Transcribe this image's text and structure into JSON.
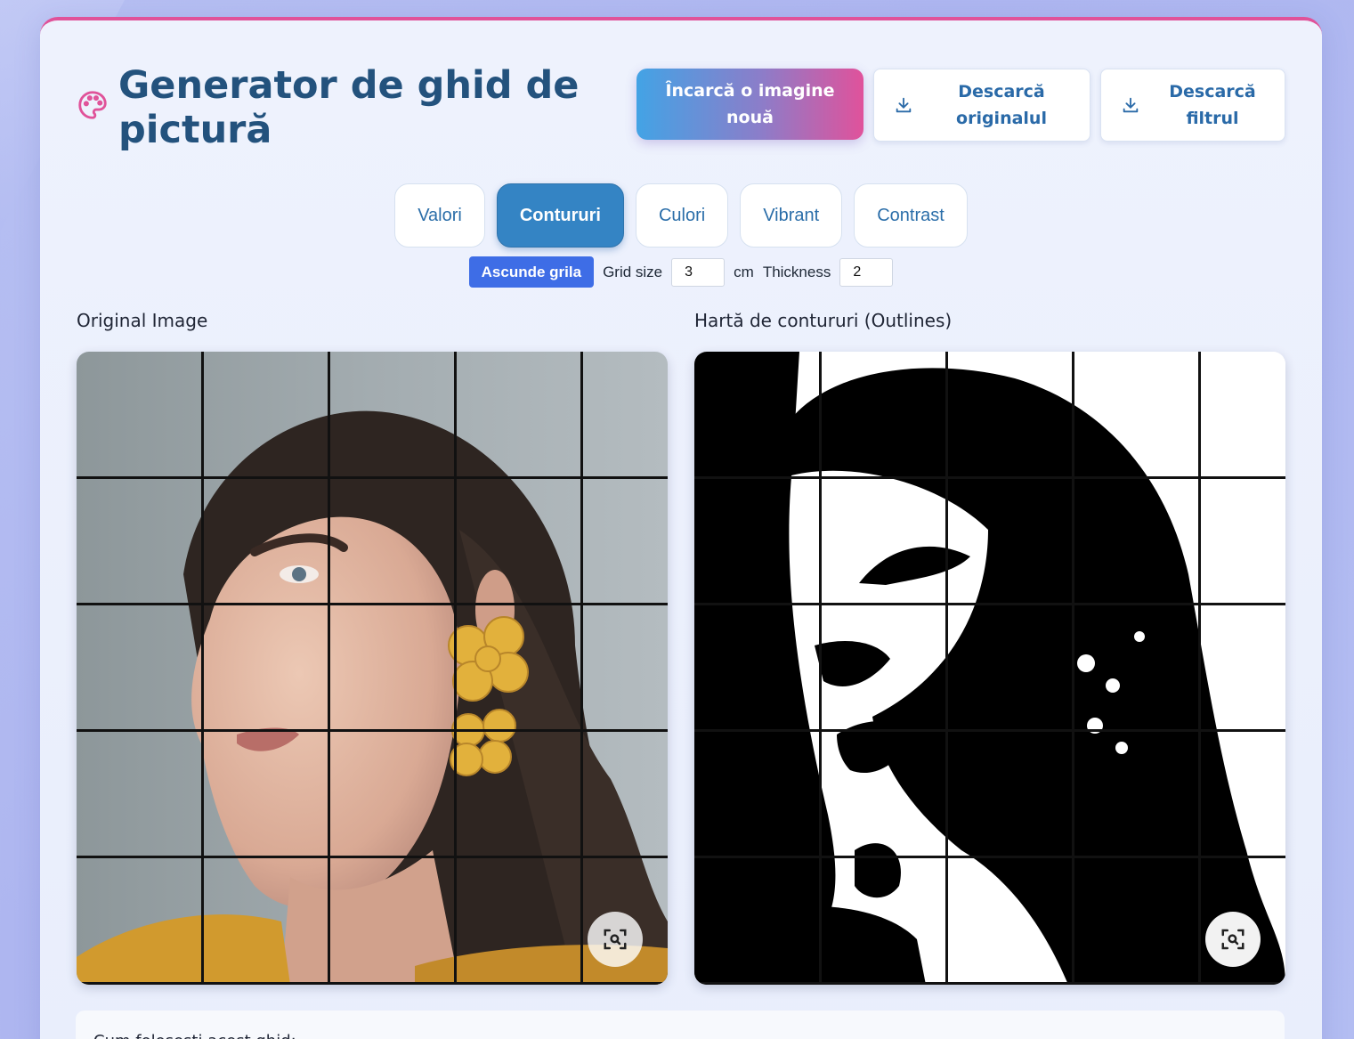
{
  "app": {
    "title": "Generator de ghid de pictură",
    "accent_color": "#e05299",
    "primary_color": "#3484c4"
  },
  "actions": {
    "upload_label": "Încarcă o imagine nouă",
    "download_original_label": "Descarcă originalul",
    "download_filter_label": "Descarcă filtrul"
  },
  "tabs": [
    {
      "label": "Valori",
      "active": false
    },
    {
      "label": "Contururi",
      "active": true
    },
    {
      "label": "Culori",
      "active": false
    },
    {
      "label": "Vibrant",
      "active": false
    },
    {
      "label": "Contrast",
      "active": false
    }
  ],
  "controls": {
    "grid_toggle_label": "Ascunde grila",
    "grid_size_label": "Grid size",
    "grid_size_value": "3",
    "grid_size_unit": "cm",
    "thickness_label": "Thickness",
    "thickness_value": "2"
  },
  "panels": {
    "original_title": "Original Image",
    "filtered_title": "Hartă de contururi (Outlines)"
  },
  "help": {
    "title": "Cum folosești acest ghid:"
  },
  "icons": {
    "header": "palette-icon",
    "download": "download-icon",
    "zoom": "zoom-icon"
  }
}
